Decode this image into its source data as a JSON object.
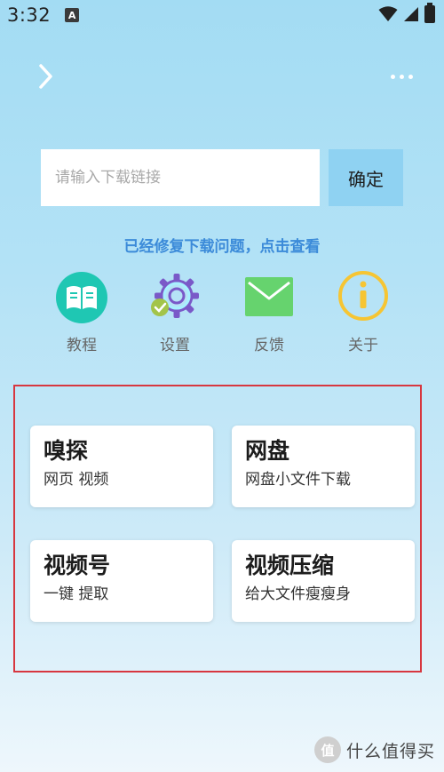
{
  "status_bar": {
    "time": "3:32",
    "notification_icon": "A",
    "icons": [
      "wifi-icon",
      "signal-icon",
      "battery-icon"
    ]
  },
  "header": {
    "back_icon": "chevron-right-icon",
    "more_icon": "more-dots-icon"
  },
  "search": {
    "placeholder": "请输入下载链接",
    "value": "",
    "confirm_label": "确定"
  },
  "notice": {
    "text": "已经修复下载问题，点击查看"
  },
  "quick_icons": [
    {
      "label": "教程",
      "icon": "book-icon",
      "color": "#1fc7b3"
    },
    {
      "label": "设置",
      "icon": "gear-icon",
      "color": "#7a59c8"
    },
    {
      "label": "反馈",
      "icon": "mail-icon",
      "color": "#66d36e"
    },
    {
      "label": "关于",
      "icon": "info-icon",
      "color": "#f6c533"
    }
  ],
  "feature_cards": [
    {
      "title": "嗅探",
      "subtitle": "网页 视频"
    },
    {
      "title": "网盘",
      "subtitle": "网盘小文件下载"
    },
    {
      "title": "视频号",
      "subtitle": "一键 提取"
    },
    {
      "title": "视频压缩",
      "subtitle": "给大文件瘦瘦身"
    }
  ],
  "highlight_frame_color": "#d7373f",
  "watermark": {
    "logo_text": "值",
    "text": "什么值得买"
  }
}
